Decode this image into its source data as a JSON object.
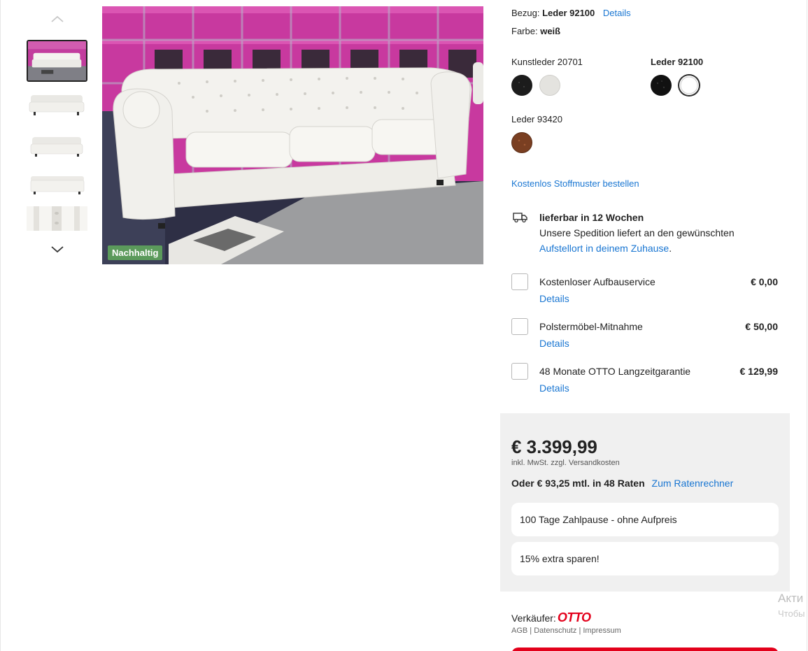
{
  "gallery": {
    "badge": "Nachhaltig",
    "thumbnails": [
      "thumb-1",
      "thumb-2",
      "thumb-3",
      "thumb-4",
      "thumb-5"
    ]
  },
  "material": {
    "bezug_label": "Bezug:",
    "bezug_value": "Leder 92100",
    "details_link": "Details",
    "farbe_label": "Farbe:",
    "farbe_value": "weiß"
  },
  "swatch_groups": [
    {
      "name": "Kunstleder 20701",
      "swatches": [
        {
          "color": "#1c1c1c"
        },
        {
          "color": "#e4e3df"
        }
      ]
    },
    {
      "name": "Leder 92100",
      "swatches": [
        {
          "color": "#111111"
        },
        {
          "color": "#ffffff"
        }
      ]
    },
    {
      "name": "Leder 93420",
      "swatches": [
        {
          "color": "#7a3f22"
        }
      ]
    }
  ],
  "fabric_sample_link": "Kostenlos Stoffmuster bestellen",
  "delivery": {
    "icon": "truck-icon",
    "title": "lieferbar in 12 Wochen",
    "text": "Unsere Spedition liefert an den gewünschten",
    "link": "Aufstellort in deinem Zuhause",
    "suffix": "."
  },
  "services": [
    {
      "label": "Kostenloser Aufbauservice",
      "price": "€ 0,00",
      "details": "Details"
    },
    {
      "label": "Polstermöbel-Mitnahme",
      "price": "€ 50,00",
      "details": "Details"
    },
    {
      "label": "48 Monate OTTO Langzeitgarantie",
      "price": "€ 129,99",
      "details": "Details"
    }
  ],
  "price": {
    "main": "€ 3.399,99",
    "vat_text": "inkl. MwSt. zzgl.",
    "shipping_link": "Versandkosten",
    "rate_text": "Oder € 93,25 mtl. in 48 Raten",
    "rate_link": "Zum Ratenrechner",
    "promo1": "100 Tage Zahlpause - ohne Aufpreis",
    "promo2": "15% extra sparen!"
  },
  "seller": {
    "label": "Verkäufer:",
    "name": "OTTO",
    "agb": "AGB",
    "datenschutz": "Datenschutz",
    "impressum": "Impressum",
    "sep": "|"
  },
  "watermark": {
    "line1": "Акти",
    "line2": "Чтобы"
  }
}
